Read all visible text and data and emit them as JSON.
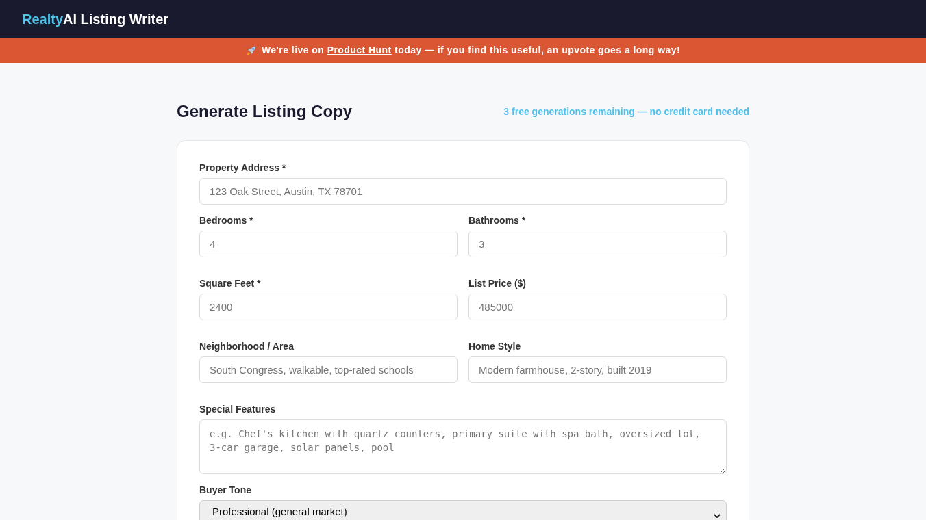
{
  "app_title": {
    "accent": "Realty",
    "text": "AI Listing Writer"
  },
  "banner": {
    "text_before": "We're live on",
    "link": "Product Hunt",
    "text_after": "today — if you find this useful, an upvote goes a long way!"
  },
  "page": {
    "title": "Generate Listing Copy",
    "quota_note": "3 free generations remaining — no credit card needed"
  },
  "form": {
    "rows": [
      {
        "fields": [
          {
            "kind": "input",
            "label": "Property Address *",
            "placeholder": "123 Oak Street, Austin, TX 78701"
          }
        ]
      },
      {
        "fields": [
          {
            "kind": "input",
            "label": "Bedrooms *",
            "placeholder": "4"
          },
          {
            "kind": "input",
            "label": "Bathrooms *",
            "placeholder": "3"
          }
        ]
      },
      {
        "fields": [
          {
            "kind": "input",
            "label": "Square Feet *",
            "placeholder": "2400"
          },
          {
            "kind": "input",
            "label": "List Price ($)",
            "placeholder": "485000"
          }
        ]
      },
      {
        "fields": [
          {
            "kind": "input",
            "label": "Neighborhood / Area",
            "placeholder": "South Congress, walkable, top-rated schools"
          },
          {
            "kind": "input",
            "label": "Home Style",
            "placeholder": "Modern farmhouse, 2-story, built 2019"
          }
        ]
      },
      {
        "fields": [
          {
            "kind": "textarea",
            "label": "Special Features",
            "placeholder": "e.g. Chef's kitchen with quartz counters, primary suite with spa bath, oversized lot, 3-car garage, solar panels, pool"
          }
        ]
      },
      {
        "fields": [
          {
            "kind": "select",
            "label": "Buyer Tone",
            "value": "Professional (general market)"
          }
        ]
      }
    ]
  }
}
